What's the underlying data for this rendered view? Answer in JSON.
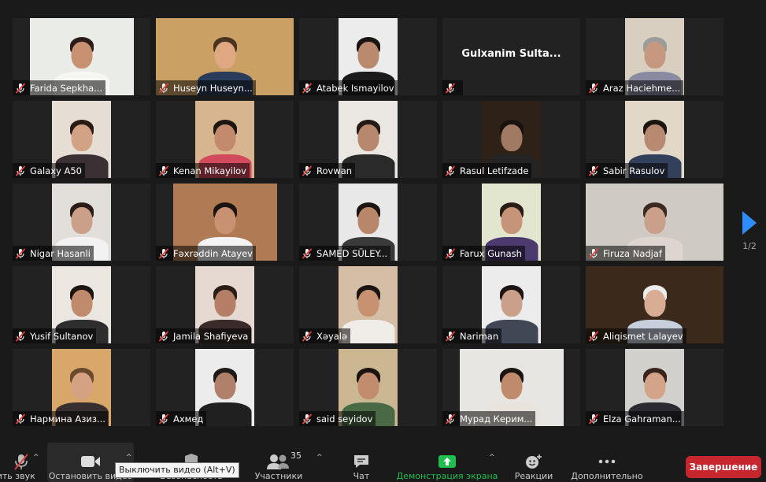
{
  "participants": [
    {
      "name": "Farida Sepkha..."
    },
    {
      "name": "Huseyn Huseyn..."
    },
    {
      "name": "Atabek Ismayilov"
    },
    {
      "name": "",
      "display_name": "Gulxanim  Sulta..."
    },
    {
      "name": "Araz Haciehme..."
    },
    {
      "name": "Galaxy A50"
    },
    {
      "name": "Kenan Mikayilov"
    },
    {
      "name": "Rovwan"
    },
    {
      "name": "Rasul Letifzade"
    },
    {
      "name": "Sabir Rasulov"
    },
    {
      "name": "Nigar Hasanli"
    },
    {
      "name": "Fəxrəddin Atayev"
    },
    {
      "name": "SAMED SÜLEY..."
    },
    {
      "name": "Farux Gunash"
    },
    {
      "name": "Firuza Nadjaf"
    },
    {
      "name": "Yusif Sultanov"
    },
    {
      "name": "Jamila Shafiyeva"
    },
    {
      "name": "Xəyalə"
    },
    {
      "name": "Nariman"
    },
    {
      "name": "Aliqismet Lalayev"
    },
    {
      "name": "Нармина Азиз..."
    },
    {
      "name": "Ахмед"
    },
    {
      "name": "said seyidov"
    },
    {
      "name": "Мурад Керим..."
    },
    {
      "name": "Elza Gahraman..."
    }
  ],
  "active_speaker": "Aliqismet Lalayev",
  "pager": {
    "page": "1/2"
  },
  "toolbar": {
    "unmute_label": "чить звук",
    "stop_video_label": "Остановить видео",
    "security_label": "Безопасность",
    "participants_label": "Участники",
    "participants_count": "35",
    "chat_label": "Чат",
    "share_label": "Демонстрация экрана",
    "reactions_label": "Реакции",
    "more_label": "Дополнительно",
    "end_label": "Завершение",
    "tooltip": "Выключить видео (Alt+V)"
  },
  "colors": {
    "share_green": "#1fbf4f",
    "end_red": "#c8262f",
    "active_border": "#d8d84a",
    "muted_icon": "#e0403a"
  }
}
